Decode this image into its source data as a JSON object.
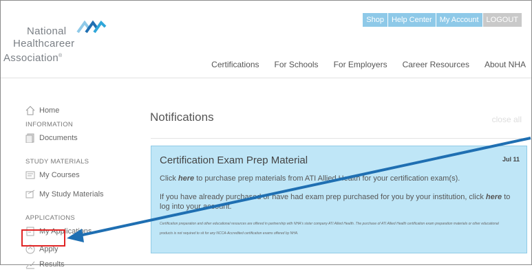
{
  "logo": {
    "line1": "National",
    "line2": "Healthcareer",
    "line3": "Association",
    "mark": "®"
  },
  "topnav": [
    "Shop",
    "Help Center",
    "My Account",
    "LOGOUT"
  ],
  "mainnav": [
    "Certifications",
    "For Schools",
    "For Employers",
    "Career Resources",
    "About NHA"
  ],
  "sidebar": {
    "home": "Home",
    "information": "INFORMATION",
    "documents": "Documents",
    "study_materials": "STUDY MATERIALS",
    "my_courses": "My Courses",
    "my_study_materials": "My Study Materials",
    "applications": "APPLICATIONS",
    "my_applications": "My Applications",
    "apply": "Apply",
    "results": "Results"
  },
  "notifications": {
    "title": "Notifications",
    "close_all": "close all"
  },
  "card": {
    "title": "Certification Exam Prep Material",
    "date": "Jul 11",
    "p1_pre": "Click ",
    "p1_link": "here",
    "p1_post": " to purchase prep materials from ATI Allied Health for your certification exam(s).",
    "p2_pre": "If you have already purchased or have had exam prep purchased for you by your institution, click ",
    "p2_link": "here",
    "p2_post": " to log into your account.",
    "fine": "Certification preparation and other educational resources are offered in partnership with NHA's sister company ATI Allied Health. The purchase of ATI Allied Health certification exam preparation materials or other educational products is not required to sit for any NCCA-Accredited certification exams offered by NHA."
  },
  "colors": {
    "accent_blue": "#8ec9e8",
    "card_bg": "#bfe6f7",
    "arrow": "#1f6fb2",
    "highlight_red": "#e02424"
  }
}
